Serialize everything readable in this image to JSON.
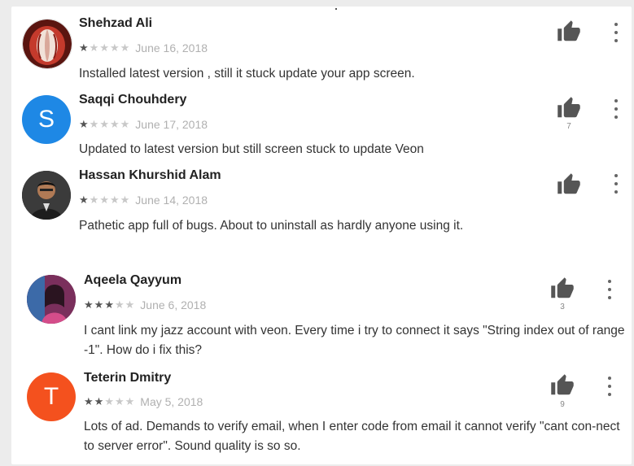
{
  "reviews": [
    {
      "name": "Shehzad Ali",
      "rating": 1,
      "date": "June 16, 2018",
      "text": "Installed latest version , still it stuck update your app screen.",
      "avatar": {
        "type": "photo",
        "icon": "red-fruit-avatar",
        "color": "#b83328"
      },
      "likes": ""
    },
    {
      "name": "Saqqi Chouhdery",
      "rating": 1,
      "date": "June 17, 2018",
      "text": "Updated to latest version but still screen stuck to update Veon",
      "avatar": {
        "type": "letter",
        "letter": "S",
        "color": "#1e88e5"
      },
      "likes": "7"
    },
    {
      "name": "Hassan Khurshid Alam",
      "rating": 1,
      "date": "June 14, 2018",
      "text": "Pathetic app full of bugs. About to uninstall as hardly anyone using it.",
      "avatar": {
        "type": "photo",
        "icon": "person-photo-avatar",
        "color": "#3a3a3a"
      },
      "likes": ""
    },
    {
      "name": "Aqeela Qayyum",
      "rating": 3,
      "date": "June 6, 2018",
      "text": "I cant link my jazz account with veon. Every time i try to connect it says \"String index out of range -1\". How do i fix this?",
      "avatar": {
        "type": "photo",
        "icon": "person-photo-avatar",
        "color": "#9b3a6e"
      },
      "likes": "3"
    },
    {
      "name": "Teterin Dmitry",
      "rating": 2,
      "date": "May 5, 2018",
      "text": "Lots of ad. Demands to verify email, when I enter code from email it cannot verify \"cant con-nect to server error\". Sound quality is so so.",
      "avatar": {
        "type": "letter",
        "letter": "T",
        "color": "#f4511e"
      },
      "likes": "9"
    }
  ]
}
